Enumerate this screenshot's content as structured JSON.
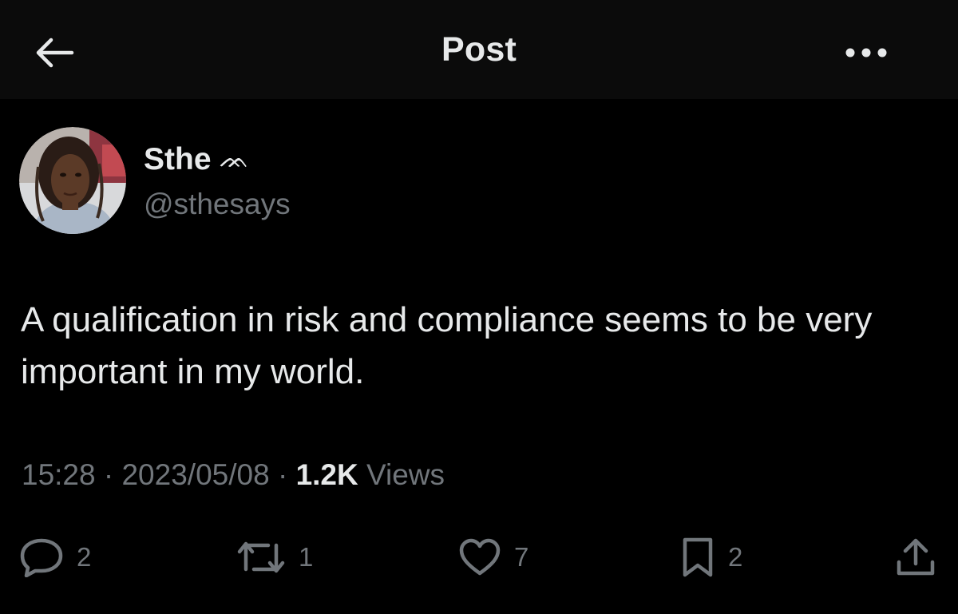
{
  "header": {
    "title": "Post",
    "back_icon": "arrow-left-icon",
    "more_icon": "more-dots-icon"
  },
  "author": {
    "display_name": "Sthe",
    "name_emoji": "ᨏ",
    "handle": "@sthesays",
    "avatar_icon": "avatar-photo"
  },
  "post": {
    "text": "A qualification in risk and compliance seems to be very important in my world."
  },
  "meta": {
    "time": "15:28",
    "separator": "·",
    "date": "2023/05/08",
    "views_count": "1.2K",
    "views_label": "Views"
  },
  "actions": {
    "reply": {
      "icon": "reply-icon",
      "count": "2"
    },
    "repost": {
      "icon": "repost-icon",
      "count": "1"
    },
    "like": {
      "icon": "heart-icon",
      "count": "7"
    },
    "bookmark": {
      "icon": "bookmark-icon",
      "count": "2"
    },
    "share": {
      "icon": "share-icon"
    }
  },
  "colors": {
    "background": "#000000",
    "header_background": "#0b0b0b",
    "primary_text": "#e7e9ea",
    "secondary_text": "#71767b"
  }
}
